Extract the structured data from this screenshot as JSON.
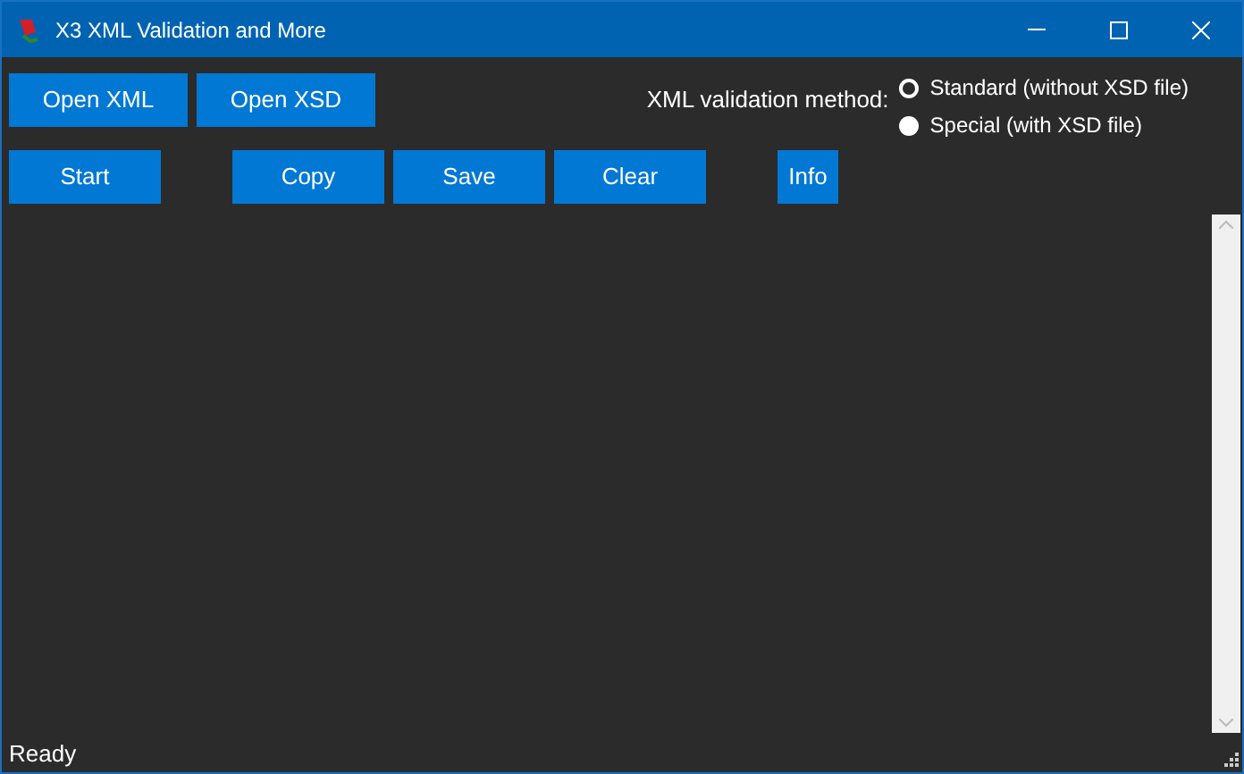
{
  "window": {
    "title": "X3 XML Validation and More"
  },
  "file_buttons": [
    "Open XML",
    "Open XSD"
  ],
  "validation": {
    "label": "XML validation method:",
    "options": [
      {
        "label": "Standard (without XSD file)",
        "selected": true
      },
      {
        "label": "Special (with XSD file)",
        "selected": false
      }
    ]
  },
  "action_buttons": [
    {
      "label": "Start",
      "kind": "wide"
    },
    {
      "label": "Copy",
      "kind": "wide"
    },
    {
      "label": "Save",
      "kind": "wide"
    },
    {
      "label": "Clear",
      "kind": "wide"
    },
    {
      "label": "Info",
      "kind": "small"
    }
  ],
  "status_bar": "Ready"
}
